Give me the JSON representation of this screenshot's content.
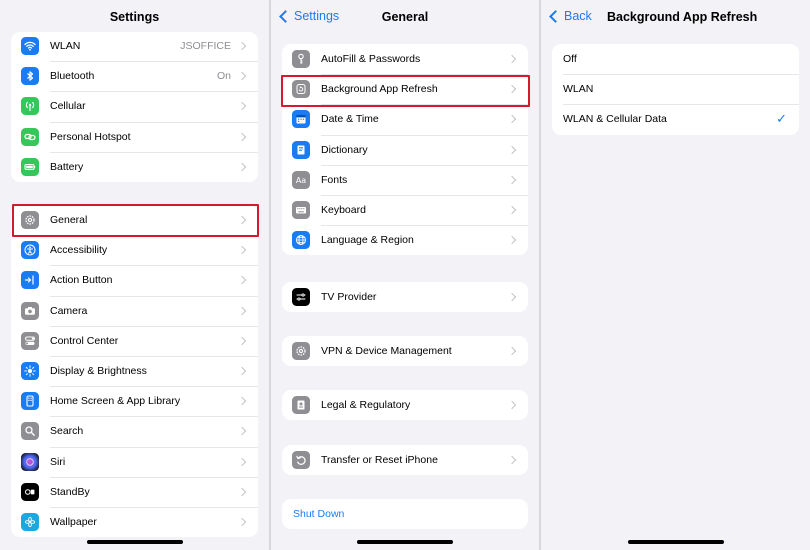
{
  "colors": {
    "accent": "#1a7cf2",
    "highlight": "#d8182f"
  },
  "settings": {
    "title": "Settings",
    "group1": [
      {
        "label": "WLAN",
        "value": "JSOFFICE",
        "icon": "wifi-icon",
        "color": "#1a7cf2"
      },
      {
        "label": "Bluetooth",
        "value": "On",
        "icon": "bluetooth-icon",
        "color": "#1a7cf2"
      },
      {
        "label": "Cellular",
        "value": "",
        "icon": "antenna-icon",
        "color": "#34c759"
      },
      {
        "label": "Personal Hotspot",
        "value": "",
        "icon": "link-icon",
        "color": "#34c759"
      },
      {
        "label": "Battery",
        "value": "",
        "icon": "battery-icon",
        "color": "#34c759"
      }
    ],
    "group2": [
      {
        "label": "General",
        "icon": "gear-icon",
        "color": "#8e8e93"
      },
      {
        "label": "Accessibility",
        "icon": "accessibility-icon",
        "color": "#1a7cf2"
      },
      {
        "label": "Action Button",
        "icon": "action-button-icon",
        "color": "#1a7cf2"
      },
      {
        "label": "Camera",
        "icon": "camera-icon",
        "color": "#8e8e93"
      },
      {
        "label": "Control Center",
        "icon": "toggles-icon",
        "color": "#8e8e93"
      },
      {
        "label": "Display & Brightness",
        "icon": "sun-icon",
        "color": "#1a7cf2"
      },
      {
        "label": "Home Screen & App Library",
        "icon": "phone-icon",
        "color": "#1a7cf2"
      },
      {
        "label": "Search",
        "icon": "search-icon",
        "color": "#8e8e93"
      },
      {
        "label": "Siri",
        "icon": "siri-icon",
        "color": "#222222"
      },
      {
        "label": "StandBy",
        "icon": "standby-icon",
        "color": "#000000"
      },
      {
        "label": "Wallpaper",
        "icon": "flower-icon",
        "color": "#1aa8e0"
      }
    ]
  },
  "general": {
    "back_label": "Settings",
    "title": "General",
    "group1": [
      {
        "label": "AutoFill & Passwords",
        "icon": "key-icon",
        "color": "#8e8e93"
      },
      {
        "label": "Background App Refresh",
        "icon": "refresh-icon",
        "color": "#8e8e93"
      },
      {
        "label": "Date & Time",
        "icon": "calendar-icon",
        "color": "#1a7cf2"
      },
      {
        "label": "Dictionary",
        "icon": "book-icon",
        "color": "#1a7cf2"
      },
      {
        "label": "Fonts",
        "icon": "font-icon",
        "color": "#8e8e93"
      },
      {
        "label": "Keyboard",
        "icon": "keyboard-icon",
        "color": "#8e8e93"
      },
      {
        "label": "Language & Region",
        "icon": "globe-icon",
        "color": "#1a7cf2"
      }
    ],
    "tv_provider": {
      "label": "TV Provider",
      "icon": "tv-provider-icon",
      "color": "#000000"
    },
    "vpn": {
      "label": "VPN & Device Management",
      "icon": "gear-icon",
      "color": "#8e8e93"
    },
    "legal": {
      "label": "Legal & Regulatory",
      "icon": "document-icon",
      "color": "#8e8e93"
    },
    "transfer": {
      "label": "Transfer or Reset iPhone",
      "icon": "reset-icon",
      "color": "#8e8e93"
    },
    "shutdown": {
      "label": "Shut Down"
    }
  },
  "bar": {
    "back_label": "Back",
    "title": "Background App Refresh",
    "options": [
      {
        "label": "Off",
        "selected": false
      },
      {
        "label": "WLAN",
        "selected": false
      },
      {
        "label": "WLAN & Cellular Data",
        "selected": true
      }
    ],
    "check_glyph": "✓"
  }
}
